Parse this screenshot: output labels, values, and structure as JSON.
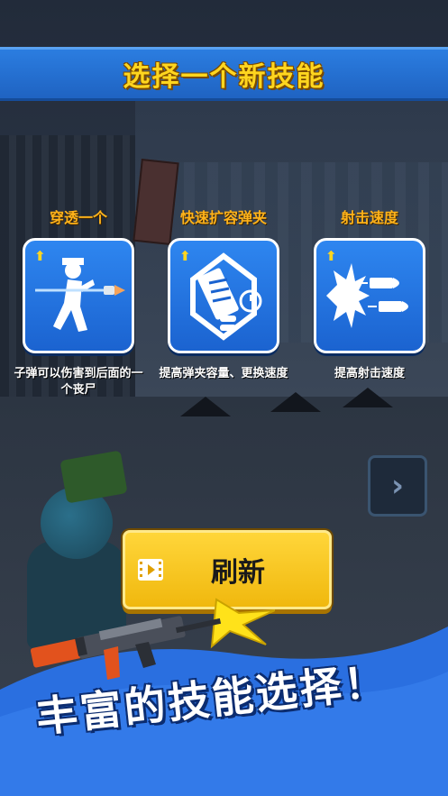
{
  "title": "选择一个新技能",
  "skills": [
    {
      "name": "穿透一个",
      "icon": "piercing-bullet-icon",
      "desc": "子弹可以伤害到后面的一个丧尸"
    },
    {
      "name": "快速扩容弹夹",
      "icon": "magazine-expand-icon",
      "desc": "提高弹夹容量、更换速度"
    },
    {
      "name": "射击速度",
      "icon": "fire-rate-icon",
      "desc": "提高射击速度"
    }
  ],
  "refresh_button": {
    "label": "刷新",
    "icon": "video-ad-icon"
  },
  "next_arrow": {
    "glyph": "›",
    "icon": "chevron-right-icon"
  },
  "promo": {
    "text": "丰富的技能选择！"
  },
  "colors": {
    "banner_blue": "#2b7de0",
    "title_yellow": "#ffd61f",
    "skill_name_orange": "#ffb31a",
    "card_blue": "#2e86f0",
    "button_yellow": "#ffd63a",
    "promo_blue": "#2a6fe0"
  }
}
